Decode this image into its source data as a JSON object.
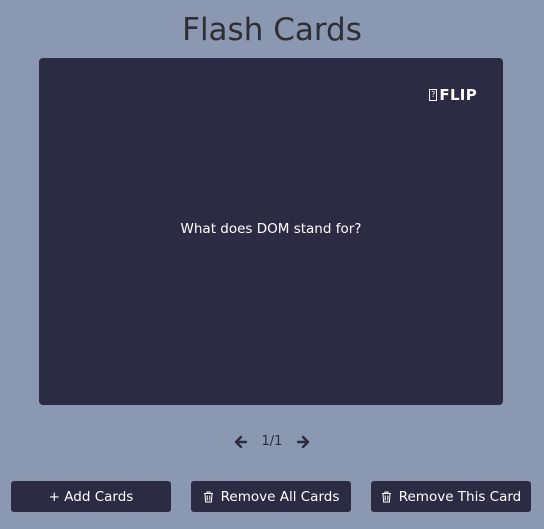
{
  "app": {
    "title": "Flash Cards"
  },
  "card": {
    "flip_label": "FLIP",
    "question": "What does DOM stand for?"
  },
  "pager": {
    "position": "1/1"
  },
  "buttons": {
    "add_label": "+ Add Cards",
    "remove_all_label": "Remove All Cards",
    "remove_this_label": "Remove This Card"
  },
  "icons": {
    "flip": "flip-icon",
    "prev": "arrow-left-icon",
    "next": "arrow-right-icon",
    "trash": "trash-icon"
  },
  "colors": {
    "background": "#8a98b2",
    "card": "#2c2b44",
    "button": "#2c2b44",
    "title": "#2e2e33",
    "text_light": "#ffffff"
  }
}
